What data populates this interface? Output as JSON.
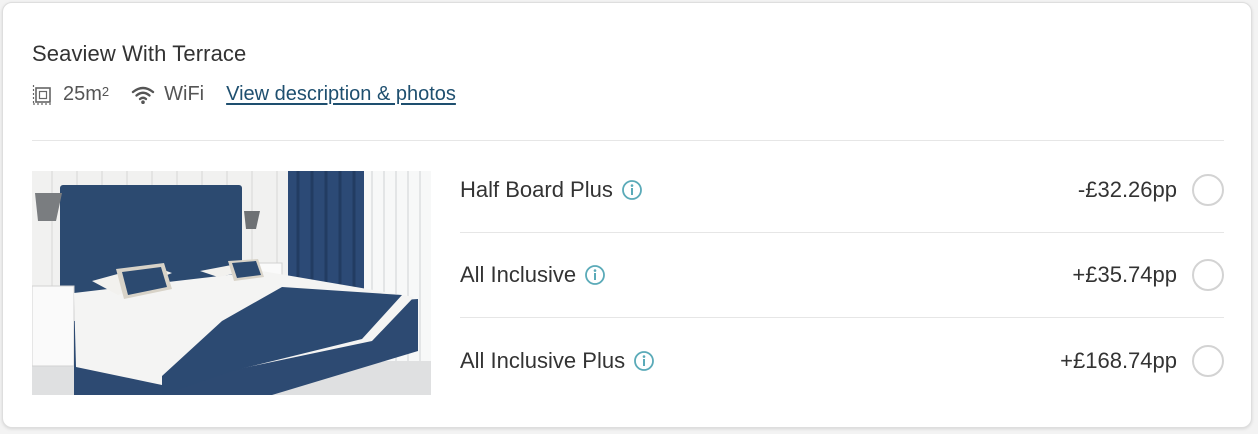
{
  "room": {
    "title": "Seaview With Terrace",
    "size_value": "25m",
    "size_sup": "2",
    "wifi_label": "WiFi",
    "description_link": "View description & photos"
  },
  "options": [
    {
      "name": "Half Board Plus",
      "price": "-£32.26pp",
      "icon": "info-icon"
    },
    {
      "name": "All Inclusive",
      "price": "+£35.74pp",
      "icon": "info-icon"
    },
    {
      "name": "All Inclusive Plus",
      "price": "+£168.74pp",
      "icon": "info-icon"
    }
  ],
  "colors": {
    "accent_info": "#5aaab8",
    "link": "#1e4f6f",
    "bedding_blue": "#2c4a70"
  }
}
